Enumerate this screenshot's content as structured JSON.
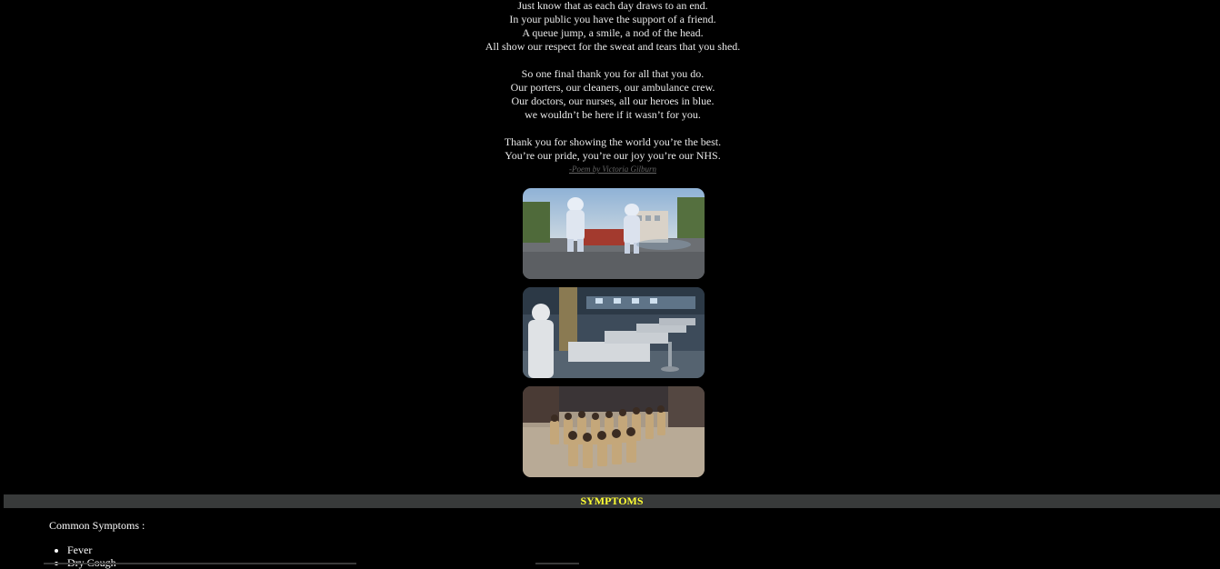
{
  "poem": {
    "stanzas": [
      [
        "Just know that as each day draws to an end.",
        "In your public you have the support of a friend.",
        "A queue jump, a smile, a nod of the head.",
        "All show our respect for the sweat and tears that you shed."
      ],
      [
        "So one final thank you for all that you do.",
        "Our porters, our cleaners, our ambulance crew.",
        "Our doctors, our nurses, all our heroes in blue.",
        "we wouldn’t be here if it wasn’t for you."
      ],
      [
        "Thank you for showing the world you’re the best.",
        "You’re our pride, you’re our joy you’re our NHS."
      ]
    ],
    "credit": "-Poem by Victoria Gilburn"
  },
  "images": [
    {
      "subject": "workers in protective suits spraying disinfectant on a street"
    },
    {
      "subject": "hospital ward with patients in beds and staff in protective gear"
    },
    {
      "subject": "police officers in masks marching on a street"
    }
  ],
  "symptoms": {
    "section_title": "SYMPTOMS",
    "heading": "Common Symptoms :",
    "items": [
      "Fever",
      "Dry Cough"
    ]
  },
  "colors": {
    "background": "#000000",
    "section_bar": "#383a3a",
    "section_title": "#ffff33",
    "text": "#e8e8e8"
  }
}
